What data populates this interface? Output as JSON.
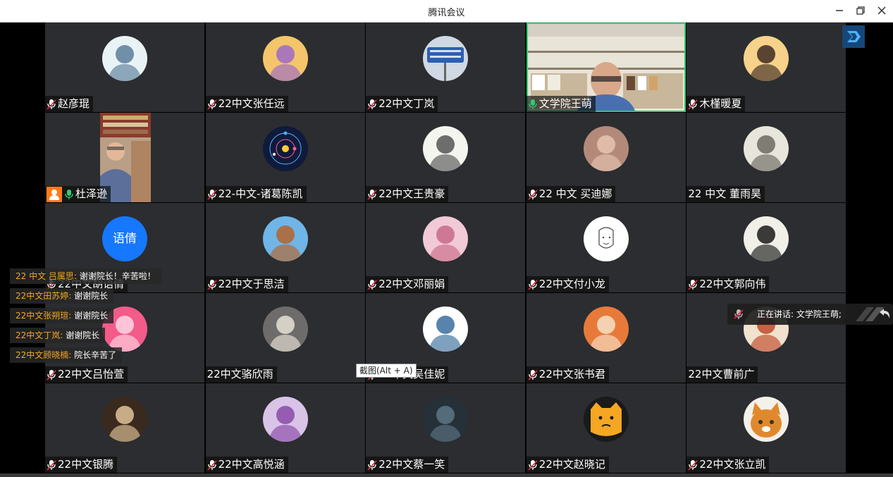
{
  "window": {
    "title": "腾讯会议"
  },
  "participants": [
    {
      "name": "赵彦琨",
      "mic": "muted",
      "avatar": "anime-sketch",
      "bg": "#e9f3f6",
      "fg": "#5a7d9a"
    },
    {
      "name": "22中文张任远",
      "mic": "muted",
      "avatar": "sunset-girl",
      "bg": "#f4c56a",
      "fg": "#9b6ac9"
    },
    {
      "name": "22中文丁岚",
      "mic": "muted",
      "avatar": "street-sign",
      "bg": "#cfd8e3",
      "fg": "#2b5fb3"
    },
    {
      "name": "文学院王萌",
      "mic": "on",
      "avatar": "video"
    },
    {
      "name": "木槿暖夏",
      "mic": "muted",
      "avatar": "girl-portrait",
      "bg": "#f7d28a",
      "fg": "#3d2b22"
    },
    {
      "name": "杜泽逊",
      "mic": "on",
      "host": true,
      "avatar": "video"
    },
    {
      "name": "22-中文-诸葛陈凯",
      "mic": "muted",
      "avatar": "solar-system",
      "bg": "#101a3a",
      "fg": "#4ab0ff"
    },
    {
      "name": "22中文王贵豪",
      "mic": "muted",
      "avatar": "boy-sketch",
      "bg": "#f5f5f0",
      "fg": "#555"
    },
    {
      "name": "22 中文 买迪娜",
      "mic": "muted",
      "avatar": "face-photo",
      "bg": "#b38a7a",
      "fg": "#e6c3b0"
    },
    {
      "name": "22 中文 董雨昊",
      "mic": "none",
      "avatar": "ancient-warrior",
      "bg": "#e8e5dc",
      "fg": "#6c6a60"
    },
    {
      "name": "22中文胡语倩",
      "mic": "muted",
      "avatar": "text",
      "avatar_text": "语倩",
      "bg": "#1677ff",
      "fg": "#ffffff"
    },
    {
      "name": "22中文于思洁",
      "mic": "muted",
      "avatar": "cartoon-squirrel",
      "bg": "#6fb5e8",
      "fg": "#b5652b"
    },
    {
      "name": "22中文邓丽娟",
      "mic": "muted",
      "avatar": "anime-pink",
      "bg": "#f2c9d6",
      "fg": "#c76b89"
    },
    {
      "name": "22中文付小龙",
      "mic": "muted",
      "avatar": "line-face",
      "bg": "#ffffff",
      "fg": "#444"
    },
    {
      "name": "22中文郭向伟",
      "mic": "muted",
      "avatar": "ink-wave",
      "bg": "#f0efe8",
      "fg": "#1a1a1a"
    },
    {
      "name": "22中文吕怡萱",
      "mic": "muted",
      "avatar": "red-hair",
      "bg": "#f25b8a",
      "fg": "#ffd7e4"
    },
    {
      "name": "22中文骆欣雨",
      "mic": "none",
      "avatar": "cat-photo",
      "bg": "#6d6c6a",
      "fg": "#e8e2d6"
    },
    {
      "name": "22中文吴佳妮",
      "mic": "muted",
      "avatar": "anime-girl",
      "bg": "#ffffff",
      "fg": "#3a6e9e"
    },
    {
      "name": "22中文张书君",
      "mic": "muted",
      "avatar": "costume-girl",
      "bg": "#e77a3a",
      "fg": "#f6e0c8"
    },
    {
      "name": "22中文曹前广",
      "mic": "none",
      "avatar": "sunset-scene",
      "bg": "#f0e2cf",
      "fg": "#c04a2a"
    },
    {
      "name": "22中文银腾",
      "mic": "muted",
      "avatar": "dog-photo",
      "bg": "#3a2a1e",
      "fg": "#e0c49a"
    },
    {
      "name": "22中文高悦涵",
      "mic": "muted",
      "avatar": "anime-purple",
      "bg": "#d9c4e8",
      "fg": "#8a4aa8"
    },
    {
      "name": "22中文蔡一笑",
      "mic": "muted",
      "avatar": "dark-photo",
      "bg": "#253038",
      "fg": "#5d7585"
    },
    {
      "name": "22中文赵晓记",
      "mic": "muted",
      "avatar": "cartoon-cat",
      "bg": "#1a1a1a",
      "fg": "#f5a623"
    },
    {
      "name": "22中文张立凯",
      "mic": "muted",
      "avatar": "kitten",
      "bg": "#f4f0ea",
      "fg": "#e0892c"
    }
  ],
  "chat": [
    {
      "sender": "22 中文 吕属思:",
      "msg": "谢谢院长！辛苦啦！"
    },
    {
      "sender": "22中文田苏婷:",
      "msg": "谢谢院长"
    },
    {
      "sender": "22中文张朔瑄:",
      "msg": "谢谢院长"
    },
    {
      "sender": "22中文丁岚:",
      "msg": "谢谢院长"
    },
    {
      "sender": "22中文顾晓楠:",
      "msg": "院长辛苦了"
    }
  ],
  "tooltip": "截图(Alt + A)",
  "speaking": "正在讲话: 文学院王萌;",
  "colors": {
    "host_badge": "#ff7a1a",
    "chat_sender": "#f5a623",
    "tile_bg": "#2b2d30",
    "accent_blue": "#1677ff",
    "mic_active": "#2ecc71"
  },
  "icons": {
    "mic_muted": "mic-muted-icon",
    "mic_on": "mic-icon",
    "host": "host-icon",
    "minimize": "minimize-icon",
    "restore": "restore-icon",
    "close": "close-icon",
    "tencent": "tencent-meeting-logo-icon"
  }
}
